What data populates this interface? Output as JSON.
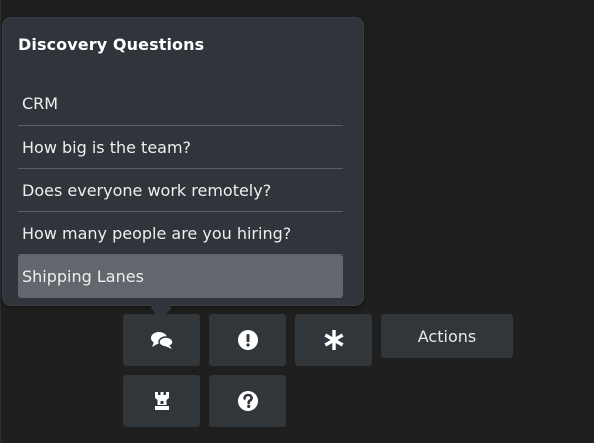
{
  "popover": {
    "title": "Discovery Questions",
    "items": [
      {
        "label": "CRM"
      },
      {
        "label": "How big is the team?"
      },
      {
        "label": "Does everyone work remotely?"
      },
      {
        "label": "How many people are you hiring?"
      },
      {
        "label": "Shipping Lanes"
      }
    ],
    "selected_index": 4
  },
  "toolbar": {
    "buttons": [
      {
        "icon": "comments-icon"
      },
      {
        "icon": "exclamation-circle-icon"
      },
      {
        "icon": "asterisk-icon"
      },
      {
        "label": "Actions"
      },
      {
        "icon": "rook-icon"
      },
      {
        "icon": "question-circle-icon"
      }
    ]
  },
  "colors": {
    "background": "#1f1f1f",
    "panel": "#30353b",
    "selected_item": "#63676d",
    "button": "#31363b",
    "text": "#ffffff"
  }
}
